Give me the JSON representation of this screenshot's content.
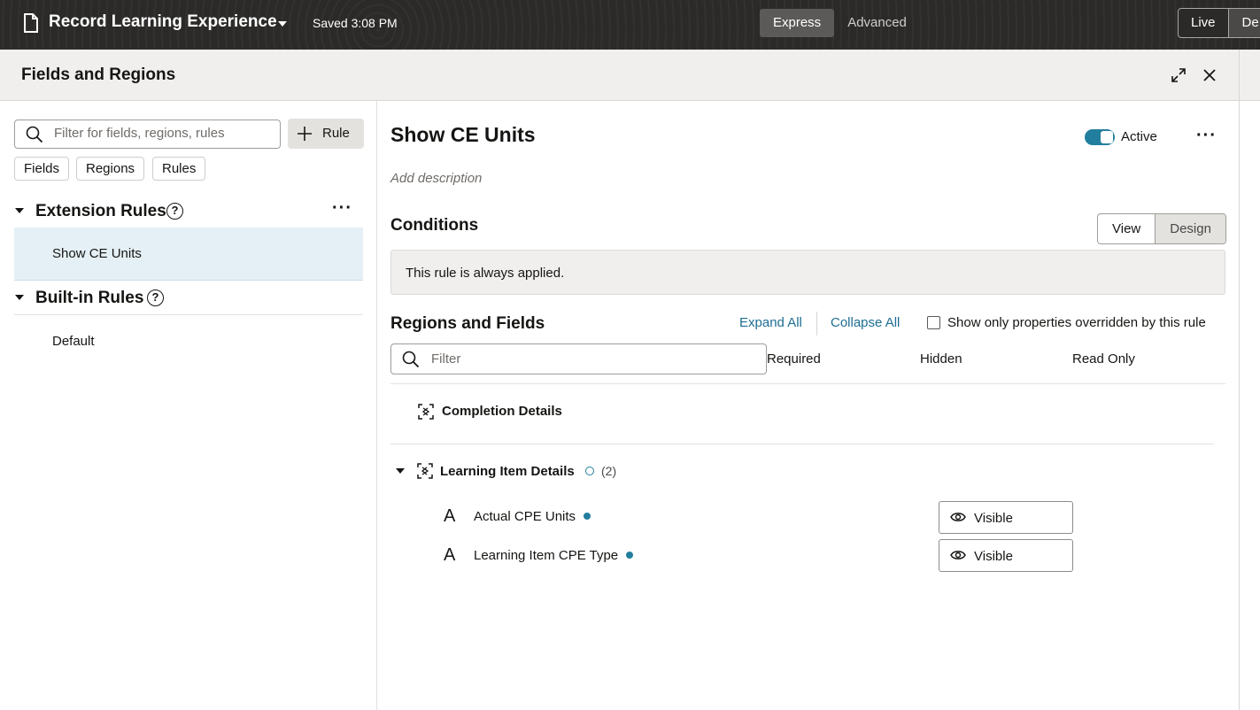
{
  "topbar": {
    "title": "Record Learning Experience",
    "saved": "Saved 3:08 PM",
    "modes": [
      "Express",
      "Advanced"
    ],
    "active_mode": "Express",
    "live_label": "Live",
    "second_label": "De"
  },
  "panel": {
    "title": "Fields and Regions"
  },
  "left": {
    "search_placeholder": "Filter for fields, regions, rules",
    "rule_button": "Rule",
    "chips": [
      "Fields",
      "Regions",
      "Rules"
    ],
    "extension_rules_title": "Extension Rules",
    "extension_rules": [
      "Show CE Units"
    ],
    "builtin_rules_title": "Built-in Rules",
    "builtin_rules": [
      "Default"
    ]
  },
  "main": {
    "title": "Show CE Units",
    "active_label": "Active",
    "add_description": "Add description",
    "conditions_title": "Conditions",
    "view_label": "View",
    "design_label": "Design",
    "condition_text": "This rule is always applied.",
    "regions_title": "Regions and Fields",
    "expand_all": "Expand All",
    "collapse_all": "Collapse All",
    "show_only_label": "Show only properties overridden by this rule",
    "filter_placeholder": "Filter",
    "columns": [
      "Required",
      "Hidden",
      "Read Only"
    ],
    "regions": [
      {
        "label": "Completion Details"
      },
      {
        "label": "Learning Item Details",
        "count": "(2)",
        "fields": [
          {
            "label": "Actual CPE Units",
            "visibility": "Visible"
          },
          {
            "label": "Learning Item CPE Type",
            "visibility": "Visible"
          }
        ]
      }
    ]
  },
  "colors": {
    "accent": "#227e9e",
    "link": "#1e6d91",
    "topbar": "#2b2a29",
    "selected_row": "#e4f0f5"
  },
  "icons": [
    "page-icon",
    "chevron-down-icon",
    "expand-icon",
    "close-icon",
    "search-icon",
    "plus-icon",
    "help-icon",
    "more-icon",
    "region-icon",
    "text-field-icon",
    "eye-icon"
  ]
}
